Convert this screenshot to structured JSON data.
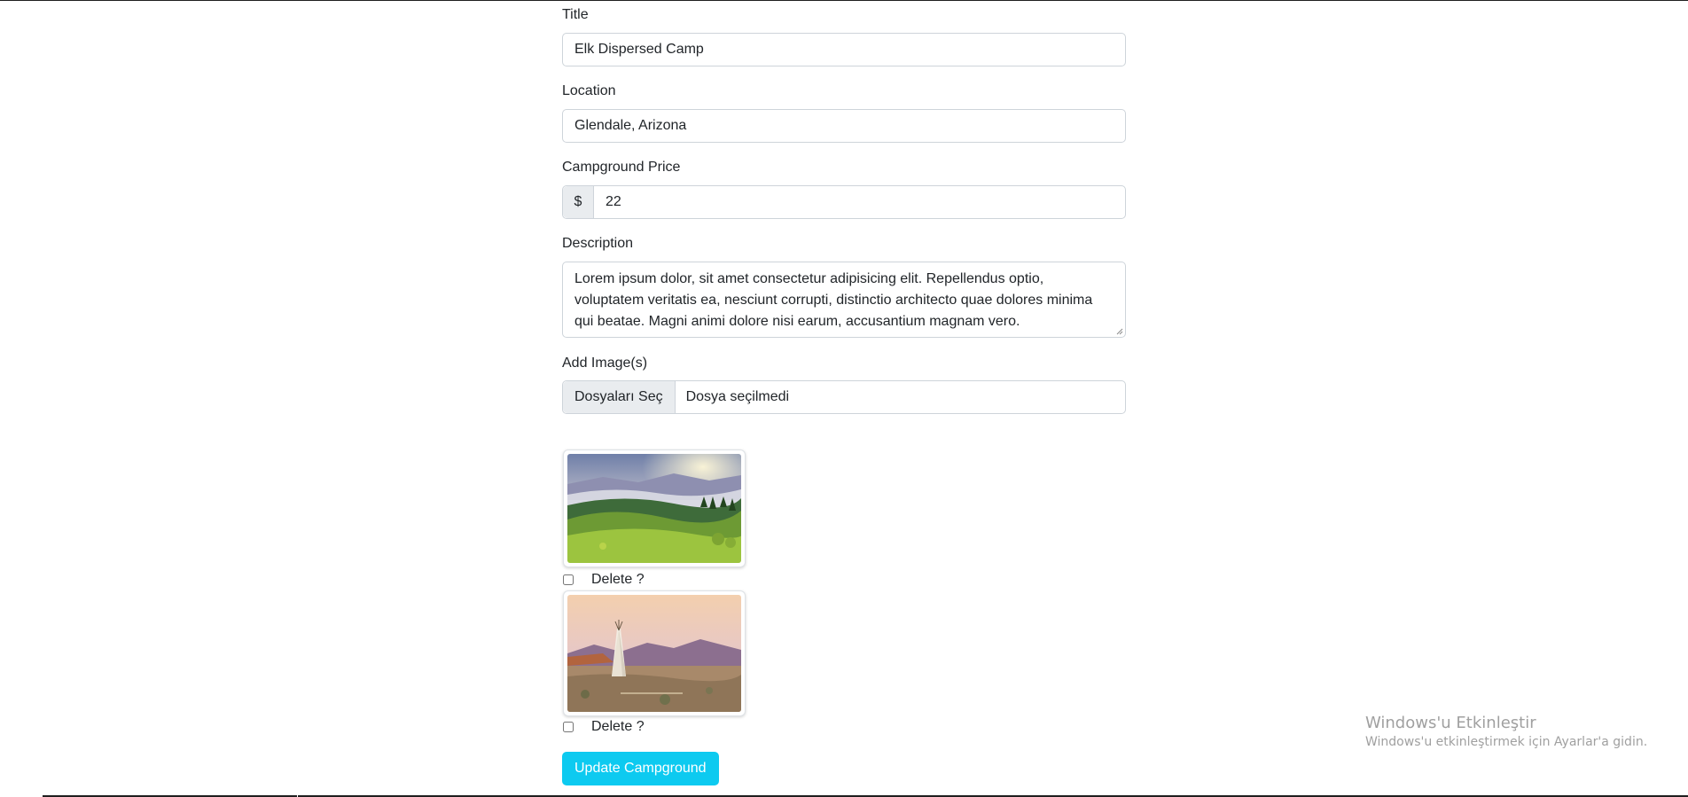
{
  "form": {
    "title": {
      "label": "Title",
      "value": "Elk Dispersed Camp"
    },
    "location": {
      "label": "Location",
      "value": "Glendale, Arizona"
    },
    "price": {
      "label": "Campground Price",
      "currency": "$",
      "value": "22"
    },
    "description": {
      "label": "Description",
      "value": "Lorem ipsum dolor, sit amet consectetur adipisicing elit. Repellendus optio, voluptatem veritatis ea, nesciunt corrupti, distinctio architecto quae dolores minima qui beatae. Magni animi dolore nisi earum, accusantium magnam vero."
    },
    "images": {
      "label": "Add Image(s)",
      "button": "Dosyaları Seç",
      "status": "Dosya seçilmedi"
    },
    "existing_images": [
      {
        "delete_label": "Delete ?",
        "checked": false
      },
      {
        "delete_label": "Delete ?",
        "checked": false
      }
    ],
    "submit_label": "Update Campground"
  },
  "watermark": {
    "title": "Windows'u Etkinleştir",
    "subtitle": "Windows'u etkinleştirmek için Ayarlar'a gidin."
  },
  "colors": {
    "submit": "#0dcaf0",
    "border": "#ced4da",
    "addon": "#e9ecef"
  }
}
